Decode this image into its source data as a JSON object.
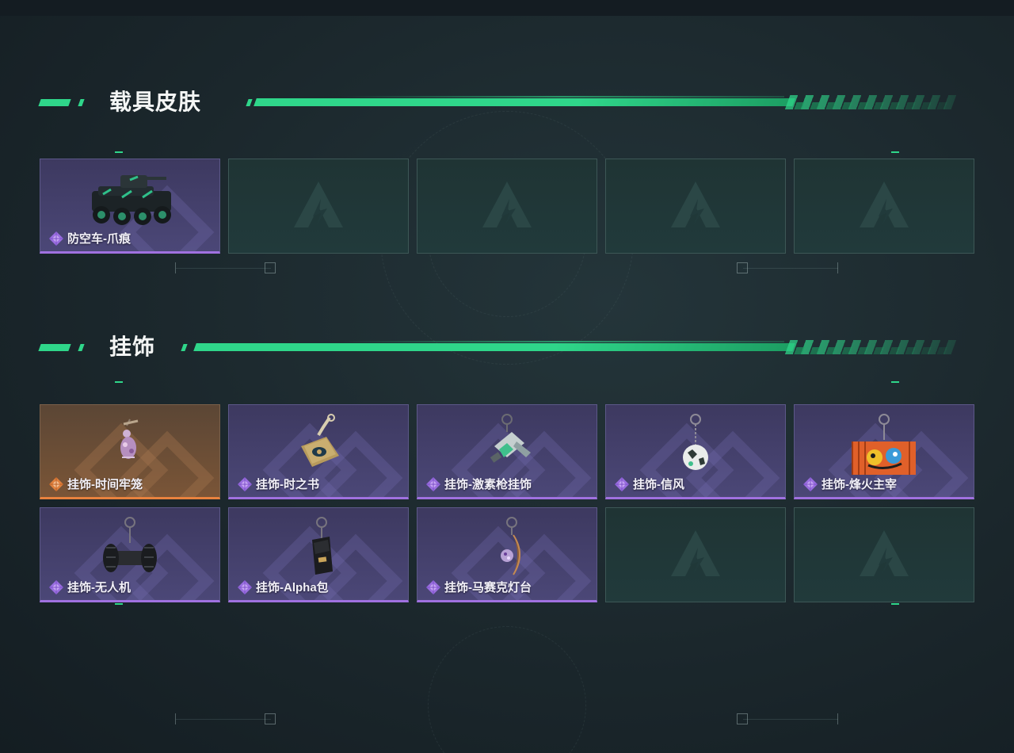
{
  "sections": [
    {
      "title": "载具皮肤",
      "items": [
        {
          "name": "防空车-爪痕",
          "rarity": "purple",
          "icon": "armored-vehicle-icon"
        },
        {
          "empty": true
        },
        {
          "empty": true
        },
        {
          "empty": true
        },
        {
          "empty": true
        }
      ]
    },
    {
      "title": "挂饰",
      "items": [
        {
          "name": "挂饰-时间牢笼",
          "rarity": "orange",
          "icon": "pendant-cage-icon"
        },
        {
          "name": "挂饰-时之书",
          "rarity": "purple",
          "icon": "pendant-book-icon"
        },
        {
          "name": "挂饰-激素枪挂饰",
          "rarity": "purple",
          "icon": "pendant-injector-gun-icon"
        },
        {
          "name": "挂饰-信风",
          "rarity": "purple",
          "icon": "pendant-ball-icon"
        },
        {
          "name": "挂饰-烽火主宰",
          "rarity": "purple",
          "icon": "pendant-container-icon"
        },
        {
          "name": "挂饰-无人机",
          "rarity": "purple",
          "icon": "pendant-drone-icon"
        },
        {
          "name": "挂饰-Alpha包",
          "rarity": "purple",
          "icon": "pendant-alpha-pack-icon"
        },
        {
          "name": "挂饰-马赛克灯台",
          "rarity": "purple",
          "icon": "pendant-mosaic-lamp-icon"
        },
        {
          "empty": true
        },
        {
          "empty": true
        }
      ]
    }
  ],
  "colors": {
    "accent_green": "#2fd68a",
    "rarity_purple": "#a071e0",
    "rarity_orange": "#e8823e",
    "empty_slot": "#213a3b"
  },
  "empty_slot_icon": "game-logo-icon"
}
